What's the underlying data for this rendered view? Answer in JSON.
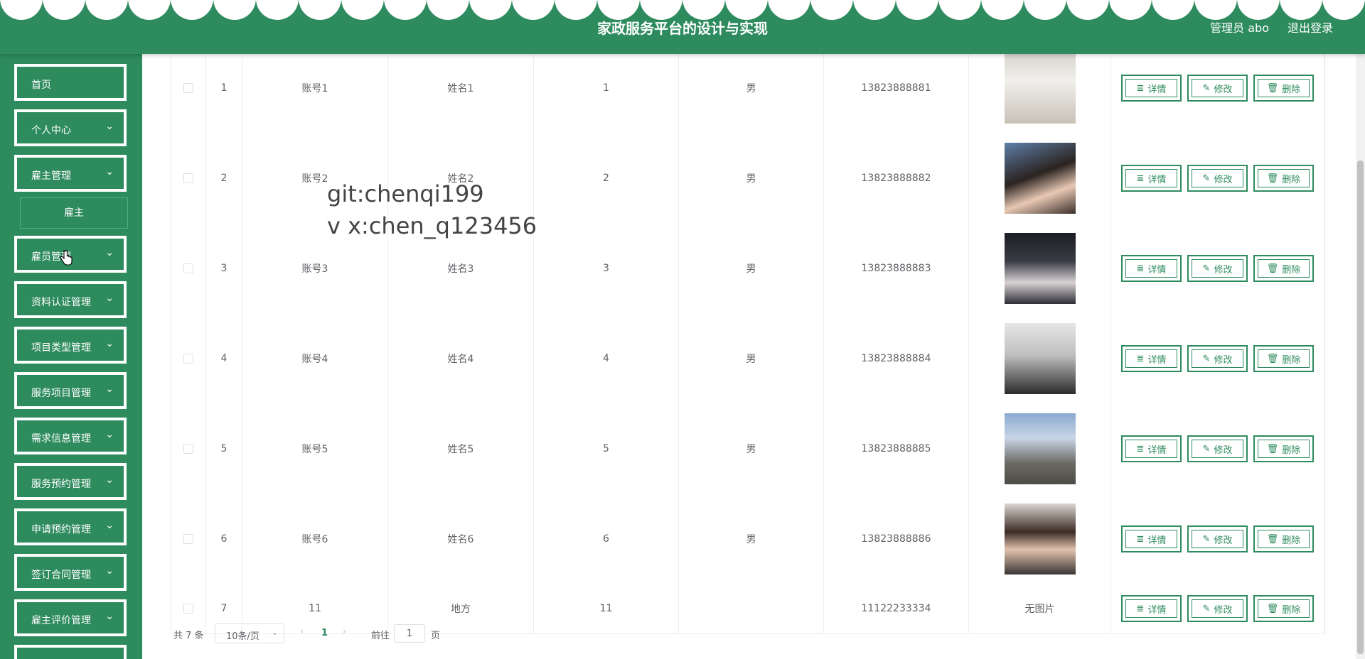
{
  "header": {
    "title": "家政服务平台的设计与实现",
    "admin_label": "管理员 abo",
    "logout_label": "退出登录"
  },
  "sidebar": {
    "items": [
      {
        "label": "首页",
        "chevron": false
      },
      {
        "label": "个人中心",
        "chevron": true
      },
      {
        "label": "雇主管理",
        "chevron": true
      },
      {
        "label": "雇员管理",
        "chevron": true
      },
      {
        "label": "资料认证管理",
        "chevron": true
      },
      {
        "label": "项目类型管理",
        "chevron": true
      },
      {
        "label": "服务项目管理",
        "chevron": true
      },
      {
        "label": "需求信息管理",
        "chevron": true
      },
      {
        "label": "服务预约管理",
        "chevron": true
      },
      {
        "label": "申请预约管理",
        "chevron": true
      },
      {
        "label": "签订合同管理",
        "chevron": true
      },
      {
        "label": "雇主评价管理",
        "chevron": true
      }
    ],
    "sub_item": "雇主",
    "chevron_glyph": "⌄"
  },
  "table": {
    "rows": [
      {
        "index": "1",
        "account": "账号1",
        "name": "姓名1",
        "age": "1",
        "gender": "男",
        "phone": "13823888881",
        "photo": "cat-photo"
      },
      {
        "index": "2",
        "account": "账号2",
        "name": "姓名2",
        "age": "2",
        "gender": "男",
        "phone": "13823888882",
        "photo": "portrait-woman-1"
      },
      {
        "index": "3",
        "account": "账号3",
        "name": "姓名3",
        "age": "3",
        "gender": "男",
        "phone": "13823888883",
        "photo": "portrait-man-1"
      },
      {
        "index": "4",
        "account": "账号4",
        "name": "姓名4",
        "age": "4",
        "gender": "男",
        "phone": "13823888884",
        "photo": "portrait-mirror-selfie"
      },
      {
        "index": "5",
        "account": "账号5",
        "name": "姓名5",
        "age": "5",
        "gender": "男",
        "phone": "13823888885",
        "photo": "portrait-man-cap"
      },
      {
        "index": "6",
        "account": "账号6",
        "name": "姓名6",
        "age": "6",
        "gender": "男",
        "phone": "13823888886",
        "photo": "portrait-woman-2"
      },
      {
        "index": "7",
        "account": "11",
        "name": "地方",
        "age": "11",
        "gender": "",
        "phone": "11122233334",
        "photo_text": "无图片"
      }
    ],
    "actions": {
      "detail": "详情",
      "edit": "修改",
      "delete": "删除"
    }
  },
  "pagination": {
    "total": "共 7 条",
    "page_size": "10条/页",
    "current_page": "1",
    "goto_label": "前往",
    "goto_value": "1",
    "page_unit": "页"
  },
  "watermark": {
    "line1": "git:chenqi199",
    "line2": "v x:chen_q123456"
  },
  "colors": {
    "primary": "#2e8b5e",
    "border": "#ebeef5",
    "text": "#606266"
  },
  "icons": {
    "detail": "document-icon",
    "edit": "pencil-icon",
    "delete": "trash-icon"
  }
}
